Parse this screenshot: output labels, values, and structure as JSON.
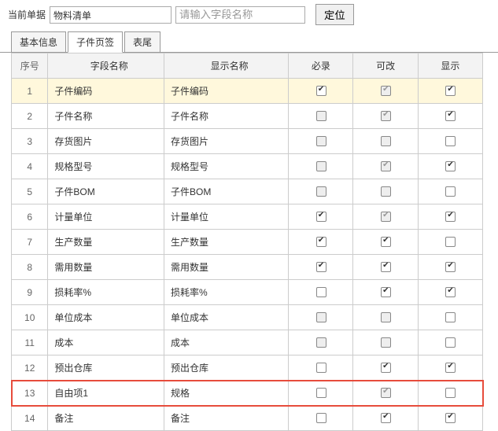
{
  "top": {
    "label": "当前单据",
    "value": "物料清单",
    "search_placeholder": "请输入字段名称",
    "locate": "定位"
  },
  "tabs": [
    "基本信息",
    "子件页签",
    "表尾"
  ],
  "active_tab": 1,
  "headers": {
    "seq": "序号",
    "field": "字段名称",
    "disp": "显示名称",
    "req": "必录",
    "edit": "可改",
    "show": "显示"
  },
  "rows": [
    {
      "seq": 1,
      "field": "子件编码",
      "disp": "子件编码",
      "req": {
        "c": true,
        "d": false
      },
      "edit": {
        "c": true,
        "d": true
      },
      "show": {
        "c": true,
        "d": false
      },
      "sel": true
    },
    {
      "seq": 2,
      "field": "子件名称",
      "disp": "子件名称",
      "req": {
        "c": false,
        "d": true
      },
      "edit": {
        "c": true,
        "d": true
      },
      "show": {
        "c": true,
        "d": false
      }
    },
    {
      "seq": 3,
      "field": "存货图片",
      "disp": "存货图片",
      "req": {
        "c": false,
        "d": true
      },
      "edit": {
        "c": false,
        "d": true
      },
      "show": {
        "c": false,
        "d": false
      }
    },
    {
      "seq": 4,
      "field": "规格型号",
      "disp": "规格型号",
      "req": {
        "c": false,
        "d": true
      },
      "edit": {
        "c": true,
        "d": true
      },
      "show": {
        "c": true,
        "d": false
      }
    },
    {
      "seq": 5,
      "field": "子件BOM",
      "disp": "子件BOM",
      "req": {
        "c": false,
        "d": true
      },
      "edit": {
        "c": false,
        "d": true
      },
      "show": {
        "c": false,
        "d": false
      }
    },
    {
      "seq": 6,
      "field": "计量单位",
      "disp": "计量单位",
      "req": {
        "c": true,
        "d": false
      },
      "edit": {
        "c": true,
        "d": true
      },
      "show": {
        "c": true,
        "d": false
      }
    },
    {
      "seq": 7,
      "field": "生产数量",
      "disp": "生产数量",
      "req": {
        "c": true,
        "d": false
      },
      "edit": {
        "c": true,
        "d": false
      },
      "show": {
        "c": false,
        "d": false
      }
    },
    {
      "seq": 8,
      "field": "需用数量",
      "disp": "需用数量",
      "req": {
        "c": true,
        "d": false
      },
      "edit": {
        "c": true,
        "d": false
      },
      "show": {
        "c": true,
        "d": false
      }
    },
    {
      "seq": 9,
      "field": "损耗率%",
      "disp": "损耗率%",
      "req": {
        "c": false,
        "d": false
      },
      "edit": {
        "c": true,
        "d": false
      },
      "show": {
        "c": true,
        "d": false
      }
    },
    {
      "seq": 10,
      "field": "单位成本",
      "disp": "单位成本",
      "req": {
        "c": false,
        "d": true
      },
      "edit": {
        "c": false,
        "d": true
      },
      "show": {
        "c": false,
        "d": false
      }
    },
    {
      "seq": 11,
      "field": "成本",
      "disp": "成本",
      "req": {
        "c": false,
        "d": true
      },
      "edit": {
        "c": false,
        "d": true
      },
      "show": {
        "c": false,
        "d": false
      }
    },
    {
      "seq": 12,
      "field": "预出仓库",
      "disp": "预出仓库",
      "req": {
        "c": false,
        "d": false
      },
      "edit": {
        "c": true,
        "d": false
      },
      "show": {
        "c": true,
        "d": false
      }
    },
    {
      "seq": 13,
      "field": "自由项1",
      "disp": "规格",
      "req": {
        "c": false,
        "d": false
      },
      "edit": {
        "c": true,
        "d": true
      },
      "show": {
        "c": false,
        "d": false
      },
      "hl": true
    },
    {
      "seq": 14,
      "field": "备注",
      "disp": "备注",
      "req": {
        "c": false,
        "d": false
      },
      "edit": {
        "c": true,
        "d": false
      },
      "show": {
        "c": true,
        "d": false
      }
    }
  ]
}
